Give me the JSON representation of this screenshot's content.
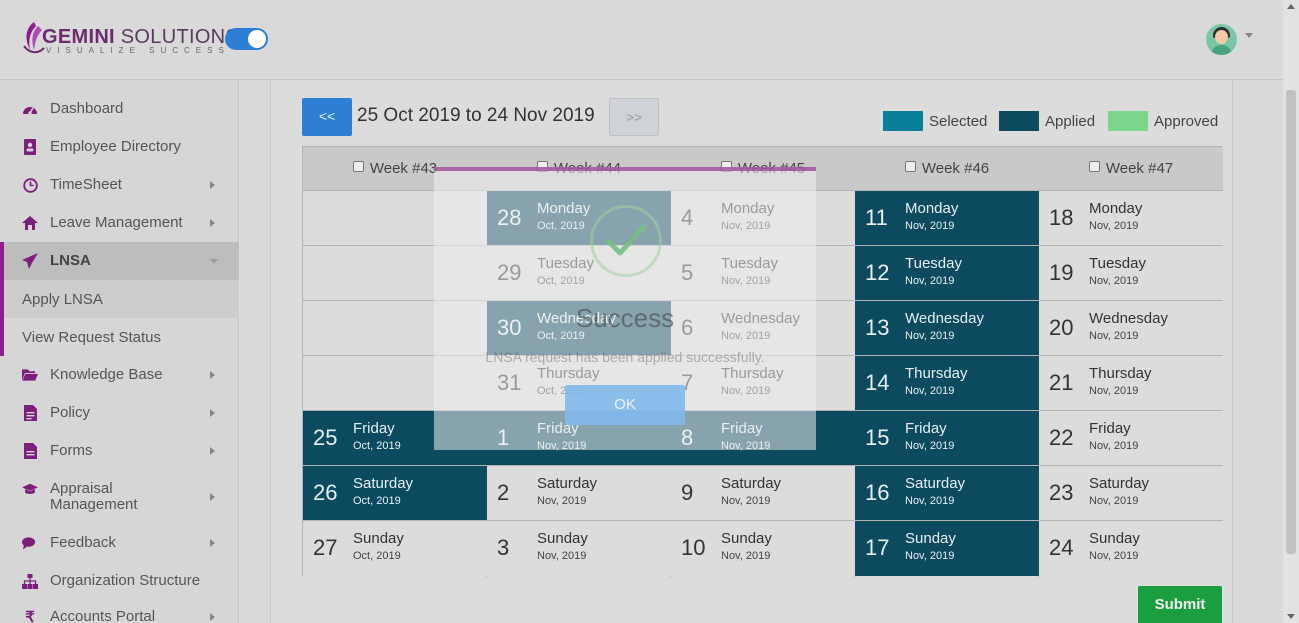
{
  "header": {
    "brand_main": "GEMINI",
    "brand_sub": " SOLUTIONS",
    "tagline": "VISUALIZE SUCCESS",
    "theme_toggle_on": true
  },
  "sidebar": {
    "items": [
      {
        "label": "Dashboard",
        "icon": "dashboard-icon",
        "has_arrow": false
      },
      {
        "label": "Employee Directory",
        "icon": "address-book-icon",
        "has_arrow": false
      },
      {
        "label": "TimeSheet",
        "icon": "clock-icon",
        "has_arrow": true
      },
      {
        "label": "Leave Management",
        "icon": "home-icon",
        "has_arrow": true
      },
      {
        "label": "LNSA",
        "icon": "paper-plane-icon",
        "has_arrow": true,
        "active": true
      },
      {
        "label": "Knowledge Base",
        "icon": "folder-open-icon",
        "has_arrow": true
      },
      {
        "label": "Policy",
        "icon": "file-text-icon",
        "has_arrow": true
      },
      {
        "label": "Forms",
        "icon": "file-icon",
        "has_arrow": true
      },
      {
        "label": "Appraisal Management",
        "label_line1": "Appraisal",
        "label_line2": "Management",
        "icon": "graduation-cap-icon",
        "has_arrow": true
      },
      {
        "label": "Feedback",
        "icon": "comments-icon",
        "has_arrow": true
      },
      {
        "label": "Organization Structure",
        "icon": "sitemap-icon",
        "has_arrow": false
      },
      {
        "label": "Accounts Portal",
        "icon": "rupee-icon",
        "has_arrow": true
      }
    ],
    "sub_items": [
      {
        "label": "Apply LNSA",
        "selected": true
      },
      {
        "label": "View Request Status",
        "selected": false
      }
    ]
  },
  "toolbar": {
    "prev_label": "<<",
    "next_label": ">>",
    "range_text": "25 Oct 2019 to 24 Nov 2019"
  },
  "legend": [
    {
      "label": "Selected",
      "color": "#0a7f9a"
    },
    {
      "label": "Applied",
      "color": "#0b4a5f"
    },
    {
      "label": "Approved",
      "color": "#7ad68a"
    }
  ],
  "calendar": {
    "weeks": [
      {
        "label": "Week #43",
        "days": [
          null,
          null,
          null,
          null,
          {
            "num": "25",
            "day": "Friday",
            "mon": "Oct, 2019",
            "status": "applied"
          },
          {
            "num": "26",
            "day": "Saturday",
            "mon": "Oct, 2019",
            "status": "applied"
          },
          {
            "num": "27",
            "day": "Sunday",
            "mon": "Oct, 2019",
            "status": "none"
          }
        ]
      },
      {
        "label": "Week #44",
        "days": [
          {
            "num": "28",
            "day": "Monday",
            "mon": "Oct, 2019",
            "status": "applied"
          },
          {
            "num": "29",
            "day": "Tuesday",
            "mon": "Oct, 2019",
            "status": "none"
          },
          {
            "num": "30",
            "day": "Wednesday",
            "mon": "Oct, 2019",
            "status": "applied"
          },
          {
            "num": "31",
            "day": "Thursday",
            "mon": "Oct, 2019",
            "status": "none"
          },
          {
            "num": "1",
            "day": "Friday",
            "mon": "Nov, 2019",
            "status": "applied"
          },
          {
            "num": "2",
            "day": "Saturday",
            "mon": "Nov, 2019",
            "status": "none"
          },
          {
            "num": "3",
            "day": "Sunday",
            "mon": "Nov, 2019",
            "status": "none"
          }
        ]
      },
      {
        "label": "Week #45",
        "days": [
          {
            "num": "4",
            "day": "Monday",
            "mon": "Nov, 2019",
            "status": "none"
          },
          {
            "num": "5",
            "day": "Tuesday",
            "mon": "Nov, 2019",
            "status": "none"
          },
          {
            "num": "6",
            "day": "Wednesday",
            "mon": "Nov, 2019",
            "status": "none"
          },
          {
            "num": "7",
            "day": "Thursday",
            "mon": "Nov, 2019",
            "status": "none"
          },
          {
            "num": "8",
            "day": "Friday",
            "mon": "Nov, 2019",
            "status": "applied"
          },
          {
            "num": "9",
            "day": "Saturday",
            "mon": "Nov, 2019",
            "status": "none"
          },
          {
            "num": "10",
            "day": "Sunday",
            "mon": "Nov, 2019",
            "status": "none"
          }
        ]
      },
      {
        "label": "Week #46",
        "days": [
          {
            "num": "11",
            "day": "Monday",
            "mon": "Nov, 2019",
            "status": "applied"
          },
          {
            "num": "12",
            "day": "Tuesday",
            "mon": "Nov, 2019",
            "status": "applied"
          },
          {
            "num": "13",
            "day": "Wednesday",
            "mon": "Nov, 2019",
            "status": "applied"
          },
          {
            "num": "14",
            "day": "Thursday",
            "mon": "Nov, 2019",
            "status": "applied"
          },
          {
            "num": "15",
            "day": "Friday",
            "mon": "Nov, 2019",
            "status": "applied"
          },
          {
            "num": "16",
            "day": "Saturday",
            "mon": "Nov, 2019",
            "status": "applied"
          },
          {
            "num": "17",
            "day": "Sunday",
            "mon": "Nov, 2019",
            "status": "applied"
          }
        ]
      },
      {
        "label": "Week #47",
        "days": [
          {
            "num": "18",
            "day": "Monday",
            "mon": "Nov, 2019",
            "status": "none"
          },
          {
            "num": "19",
            "day": "Tuesday",
            "mon": "Nov, 2019",
            "status": "none"
          },
          {
            "num": "20",
            "day": "Wednesday",
            "mon": "Nov, 2019",
            "status": "none"
          },
          {
            "num": "21",
            "day": "Thursday",
            "mon": "Nov, 2019",
            "status": "none"
          },
          {
            "num": "22",
            "day": "Friday",
            "mon": "Nov, 2019",
            "status": "none"
          },
          {
            "num": "23",
            "day": "Saturday",
            "mon": "Nov, 2019",
            "status": "none"
          },
          {
            "num": "24",
            "day": "Sunday",
            "mon": "Nov, 2019",
            "status": "none"
          }
        ]
      }
    ]
  },
  "submit_label": "Submit",
  "modal": {
    "title": "Success",
    "message": "LNSA request has been applied successfully.",
    "ok_label": "OK",
    "icon": "checkmark-icon"
  }
}
